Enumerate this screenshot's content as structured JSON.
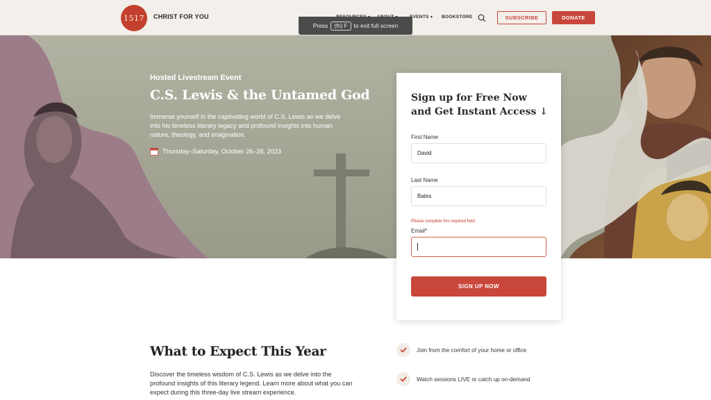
{
  "header": {
    "logo_text": "1517",
    "brand": "CHRIST FOR YOU",
    "nav": [
      {
        "label": "RESOURCES",
        "caret": "▾"
      },
      {
        "label": "ABOUT",
        "caret": "▾"
      },
      {
        "label": "EVENTS",
        "caret": "▾"
      },
      {
        "label": "BOOKSTORE",
        "caret": ""
      }
    ],
    "search_icon": "search-icon",
    "subscribe": "SUBSCRIBE",
    "donate": "DONATE"
  },
  "fullscreen_notice": {
    "prefix": "Press",
    "key": "(fn) F",
    "suffix": "to exit full screen"
  },
  "hero": {
    "eyebrow": "Hosted Livestream Event",
    "title": "C.S. Lewis & the Untamed God",
    "description": "Immerse yourself in the captivating world of C.S. Lewis as we delve into his timeless literary legacy and profound insights into human nature, theology, and imagination.",
    "date": "Thursday–Saturday, October 26–28, 2023",
    "date_icon": "calendar-icon"
  },
  "form": {
    "title": "Sign up for Free Now and Get Instant Access ↓",
    "first_name_label": "First Name",
    "first_name_value": "David",
    "last_name_label": "Last Name",
    "last_name_value": "Bates",
    "error": "Please complete this required field.",
    "email_label": "Email*",
    "email_value": "",
    "submit": "SIGN UP NOW"
  },
  "expect": {
    "title": "What to Expect This Year",
    "description": "Discover the timeless wisdom of C.S. Lewis as we delve into the profound insights of this literary legend. Learn more about what you can expect during this three-day live stream experience.",
    "items": [
      "Join from the comfort of your home or office",
      "Watch sessions LIVE or catch up on-demand"
    ]
  },
  "colors": {
    "accent": "#c9463a",
    "header_bg": "#f3efea",
    "hero_bg": "#a8a898",
    "mauve": "#9b7a86",
    "sepia": "#7a4a30",
    "gold": "#c9a24a"
  }
}
